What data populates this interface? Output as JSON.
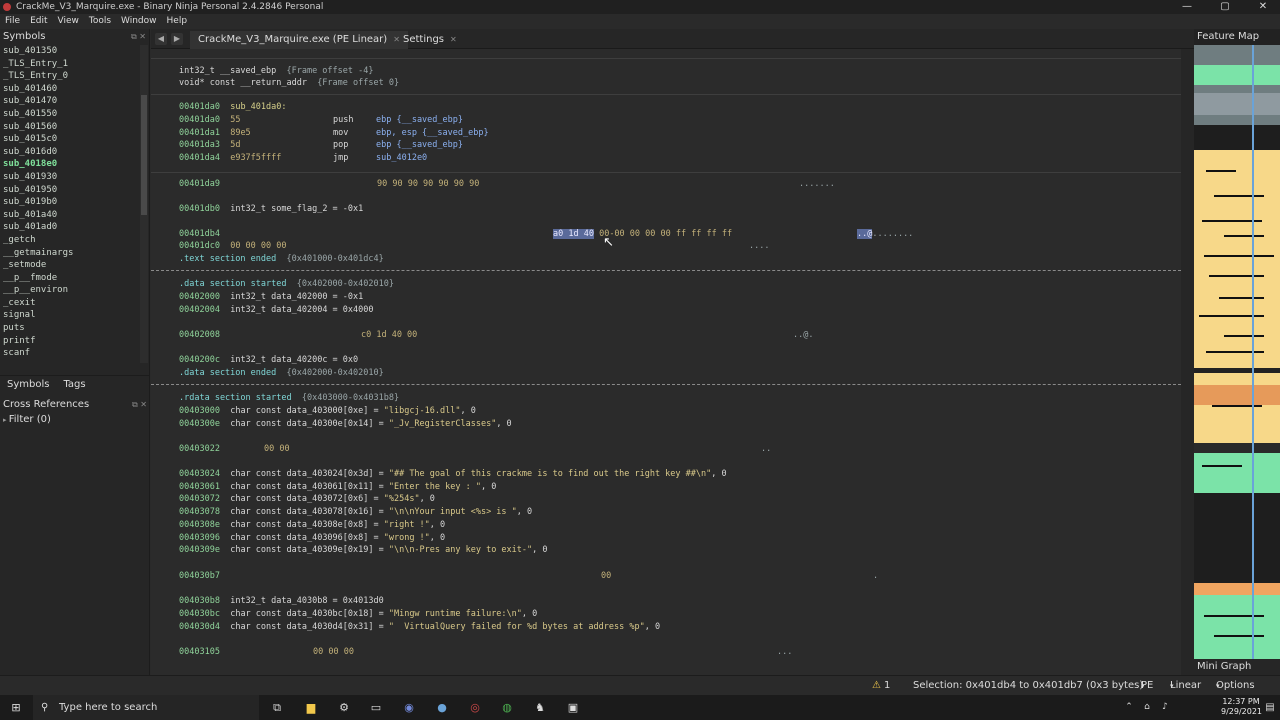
{
  "window": {
    "title": "CrackMe_V3_Marquire.exe - Binary Ninja Personal  2.4.2846 Personal",
    "controls": [
      "—",
      "▢",
      "✕"
    ]
  },
  "menu": [
    "File",
    "Edit",
    "View",
    "Tools",
    "Window",
    "Help"
  ],
  "symbols_panel": {
    "title": "Symbols",
    "items": [
      "sub_401350",
      "_TLS_Entry_1",
      "_TLS_Entry_0",
      "sub_401460",
      "sub_401470",
      "sub_401550",
      "sub_401560",
      "sub_4015c0",
      "sub_4016d0",
      "sub_4018e0",
      "sub_401930",
      "sub_401950",
      "sub_4019b0",
      "sub_401a40",
      "sub_401ad0",
      "_getch",
      "__getmainargs",
      "_setmode",
      "__p__fmode",
      "__p__environ",
      "_cexit",
      "signal",
      "puts",
      "printf",
      "scanf"
    ],
    "selected": "sub_4018e0"
  },
  "left_tabs": [
    "Symbols",
    "Tags"
  ],
  "xrefs": {
    "title": "Cross References",
    "filter": "Filter (0)"
  },
  "tabs": [
    {
      "label": "CrackMe_V3_Marquire.exe (PE Linear)",
      "active": true
    },
    {
      "label": "Settings",
      "active": false
    }
  ],
  "feature_map": {
    "title": "Feature Map"
  },
  "mini_graph": {
    "title": "Mini Graph"
  },
  "status": {
    "warnings": "1",
    "selection": "Selection: 0x401db4 to 0x401db7 (0x3 bytes)",
    "format": "PE",
    "view": "Linear",
    "options": "Options"
  },
  "taskbar": {
    "search_placeholder": "Type here to search",
    "time": "12:37 PM",
    "date": "9/29/2021"
  },
  "listing": {
    "frame1": "int32_t __saved_ebp",
    "frame1_c": "{Frame offset -4}",
    "frame2": "void* const __return_addr",
    "frame2_c": "{Frame offset 0}",
    "func_addr": "00401da0",
    "func_label": "sub_401da0:",
    "asm": [
      {
        "addr": "00401da0",
        "bytes": "55",
        "mn": "push",
        "ops": "ebp {__saved_ebp}"
      },
      {
        "addr": "00401da1",
        "bytes": "89e5",
        "mn": "mov",
        "ops": "ebp, esp {__saved_ebp}"
      },
      {
        "addr": "00401da3",
        "bytes": "5d",
        "mn": "pop",
        "ops": "ebp {__saved_ebp}"
      },
      {
        "addr": "00401da4",
        "bytes": "e937f5ffff",
        "mn": "jmp",
        "ops": "sub_4012e0"
      }
    ],
    "pad_addr": "00401da9",
    "pad_hex": "90 90 90 90 90 90 90",
    "pad_ascii": ".......",
    "flag_addr": "00401db0",
    "flag_decl": "int32_t some_flag_2 = -0x1",
    "db4_addr": "00401db4",
    "db4_hex_sel": "a0 1d 40",
    "db4_hex_rest": "00-00 00 00 00 ff ff ff ff",
    "db4_ascii_sel": "..@",
    "db4_ascii_rest": "........",
    "dc0_addr": "00401dc0",
    "dc0_hex": "00 00 00 00",
    "dc0_ascii": "....",
    "text_end": ".text section ended",
    "text_end_range": "{0x401000-0x401dc4}",
    "data_start": ".data section started",
    "data_start_range": "{0x402000-0x402010}",
    "d2000_addr": "00402000",
    "d2000": "int32_t data_402000 = -0x1",
    "d2004_addr": "00402004",
    "d2004": "int32_t data_402004 = 0x4000",
    "d2008_addr": "00402008",
    "d2008_hex": "c0 1d 40 00",
    "d2008_ascii": "..@.",
    "d200c_addr": "0040200c",
    "d200c": "int32_t data_40200c = 0x0",
    "data_end": ".data section ended",
    "data_end_range": "{0x402000-0x402010}",
    "rdata_start": ".rdata section started",
    "rdata_start_range": "{0x403000-0x4031b8}",
    "strs1": [
      {
        "addr": "00403000",
        "decl": "char const data_403000[0xe] = ",
        "val": "\"libgcj-16.dll\"",
        ", 0": ", 0"
      },
      {
        "addr": "0040300e",
        "decl": "char const data_40300e[0x14] = ",
        "val": "\"_Jv_RegisterClasses\"",
        ", 0": ", 0"
      }
    ],
    "r3022_addr": "00403022",
    "r3022_hex": "00 00",
    "r3022_ascii": "..",
    "strs2": [
      {
        "addr": "00403024",
        "decl": "char const data_403024[0x3d] = ",
        "val": "\"## The goal of this crackme is to find out the right key ##\\n\"",
        ", 0": ", 0"
      },
      {
        "addr": "00403061",
        "decl": "char const data_403061[0x11] = ",
        "val": "\"Enter the key : \"",
        ", 0": ", 0"
      },
      {
        "addr": "00403072",
        "decl": "char const data_403072[0x6] = ",
        "val": "\"%254s\"",
        ", 0": ", 0"
      },
      {
        "addr": "00403078",
        "decl": "char const data_403078[0x16] = ",
        "val": "\"\\n\\nYour input <%s> is \"",
        ", 0": ", 0"
      },
      {
        "addr": "0040308e",
        "decl": "char const data_40308e[0x8] = ",
        "val": "\"right !\"",
        ", 0": ", 0"
      },
      {
        "addr": "00403096",
        "decl": "char const data_403096[0x8] = ",
        "val": "\"wrong !\"",
        ", 0": ", 0"
      },
      {
        "addr": "0040309e",
        "decl": "char const data_40309e[0x19] = ",
        "val": "\"\\n\\n-Pres any key to exit-\"",
        ", 0": ", 0"
      }
    ],
    "r30b7_addr": "004030b7",
    "r30b7_hex": "00",
    "r30b7_ascii": ".",
    "r30b8_addr": "004030b8",
    "r30b8": "int32_t data_4030b8 = 0x4013d0",
    "strs3": [
      {
        "addr": "004030bc",
        "decl": "char const data_4030bc[0x18] = ",
        "val": "\"Mingw runtime failure:\\n\"",
        ", 0": ", 0"
      },
      {
        "addr": "004030d4",
        "decl": "char const data_4030d4[0x31] = ",
        "val": "\"  VirtualQuery failed for %d bytes at address %p\"",
        ", 0": ", 0"
      }
    ],
    "r3105_addr": "00403105",
    "r3105_hex": "00 00 00",
    "r3105_ascii": "..."
  }
}
